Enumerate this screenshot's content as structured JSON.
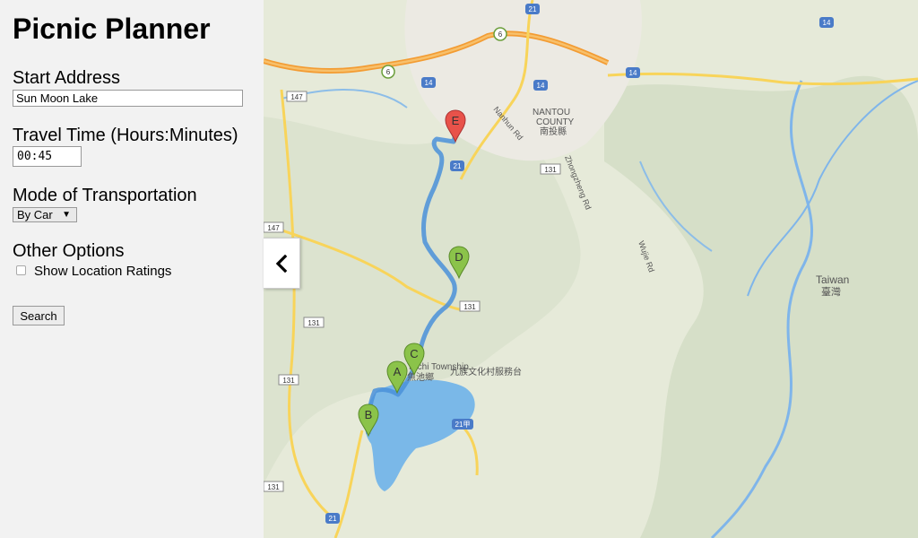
{
  "sidebar": {
    "title": "Picnic Planner",
    "start_address": {
      "label": "Start Address",
      "value": "Sun Moon Lake"
    },
    "travel_time": {
      "label": "Travel Time (Hours:Minutes)",
      "value": "00:45"
    },
    "mode": {
      "label": "Mode of Transportation",
      "selected": "By Car"
    },
    "other_options": {
      "label": "Other Options",
      "show_ratings_label": "Show Location Ratings",
      "show_ratings_checked": false
    },
    "search_label": "Search",
    "collapse_icon": "chevron-left-icon"
  },
  "map": {
    "markers": [
      "A",
      "B",
      "C",
      "D",
      "E"
    ],
    "route_color": "#4a90d9",
    "marker_green": "#8bc34a",
    "marker_red": "#e8524a",
    "road_labels": {
      "nantou_county_en": "NANTOU",
      "nantou_county_en2": "COUNTY",
      "nantou_county_zh": "南投縣",
      "nanhun_rd": "Nanhun Rd",
      "zhongzheng_rd": "Zhongzheng Rd",
      "wujie_rd": "Wujie Rd",
      "taiwan_en": "Taiwan",
      "taiwan_zh": "臺灣",
      "township_en": "Yuchi Township",
      "township_zh": "魚池鄉",
      "jiuzu_zh": "九族文化村服務台"
    },
    "shields": [
      "21",
      "6",
      "14",
      "147",
      "131",
      "21甲"
    ]
  }
}
